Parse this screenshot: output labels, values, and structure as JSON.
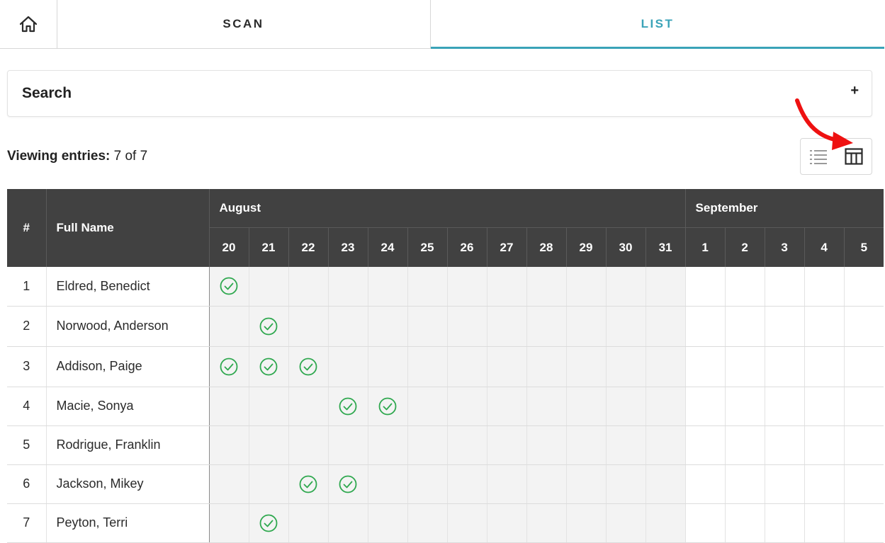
{
  "tabs": {
    "home_icon": "home-icon",
    "scan_label": "SCAN",
    "list_label": "LIST",
    "active": "LIST",
    "accent_color": "#3aa3b8"
  },
  "search": {
    "title": "Search",
    "toggle": "+"
  },
  "viewing": {
    "label": "Viewing entries:",
    "count": "7 of 7"
  },
  "view_switch": {
    "list_icon": "list-view-icon",
    "table_icon": "table-view-icon",
    "selected": "table"
  },
  "table": {
    "col_num": "#",
    "col_name": "Full Name",
    "months": [
      {
        "name": "August",
        "days": [
          "20",
          "21",
          "22",
          "23",
          "24",
          "25",
          "26",
          "27",
          "28",
          "29",
          "30",
          "31"
        ]
      },
      {
        "name": "September",
        "days": [
          "1",
          "2",
          "3",
          "4",
          "5"
        ]
      }
    ],
    "check_color": "#2fa84f",
    "rows": [
      {
        "num": "1",
        "name": "Eldred, Benedict",
        "checks": [
          "20"
        ]
      },
      {
        "num": "2",
        "name": "Norwood, Anderson",
        "checks": [
          "21"
        ]
      },
      {
        "num": "3",
        "name": "Addison, Paige",
        "checks": [
          "20",
          "21",
          "22"
        ]
      },
      {
        "num": "4",
        "name": "Macie, Sonya",
        "checks": [
          "23",
          "24"
        ]
      },
      {
        "num": "5",
        "name": "Rodrigue, Franklin",
        "checks": []
      },
      {
        "num": "6",
        "name": "Jackson, Mikey",
        "checks": [
          "22",
          "23"
        ]
      },
      {
        "num": "7",
        "name": "Peyton, Terri",
        "checks": [
          "21"
        ]
      }
    ]
  }
}
